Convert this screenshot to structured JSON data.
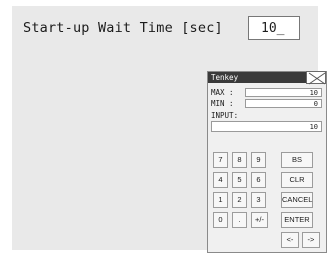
{
  "setting": {
    "label": "Start-up Wait Time [sec]",
    "value": "10_"
  },
  "tenkey": {
    "title": "Tenkey",
    "close_icon": "close-x-icon",
    "max_label": "MAX :",
    "max_value": "10",
    "min_label": "MIN :",
    "min_value": "0",
    "input_label": "INPUT:",
    "input_value": "10",
    "keys": {
      "k7": "7",
      "k8": "8",
      "k9": "9",
      "bs": "BS",
      "k4": "4",
      "k5": "5",
      "k6": "6",
      "clr": "CLR",
      "k1": "1",
      "k2": "2",
      "k3": "3",
      "cancel": "CANCEL",
      "k0": "0",
      "dot": ".",
      "sign": "+/-",
      "enter": "ENTER",
      "left": "<-",
      "right": "->"
    }
  },
  "colors": {
    "screen_bg": "#e9e9e9",
    "titlebar_bg": "#3a3a3a"
  }
}
